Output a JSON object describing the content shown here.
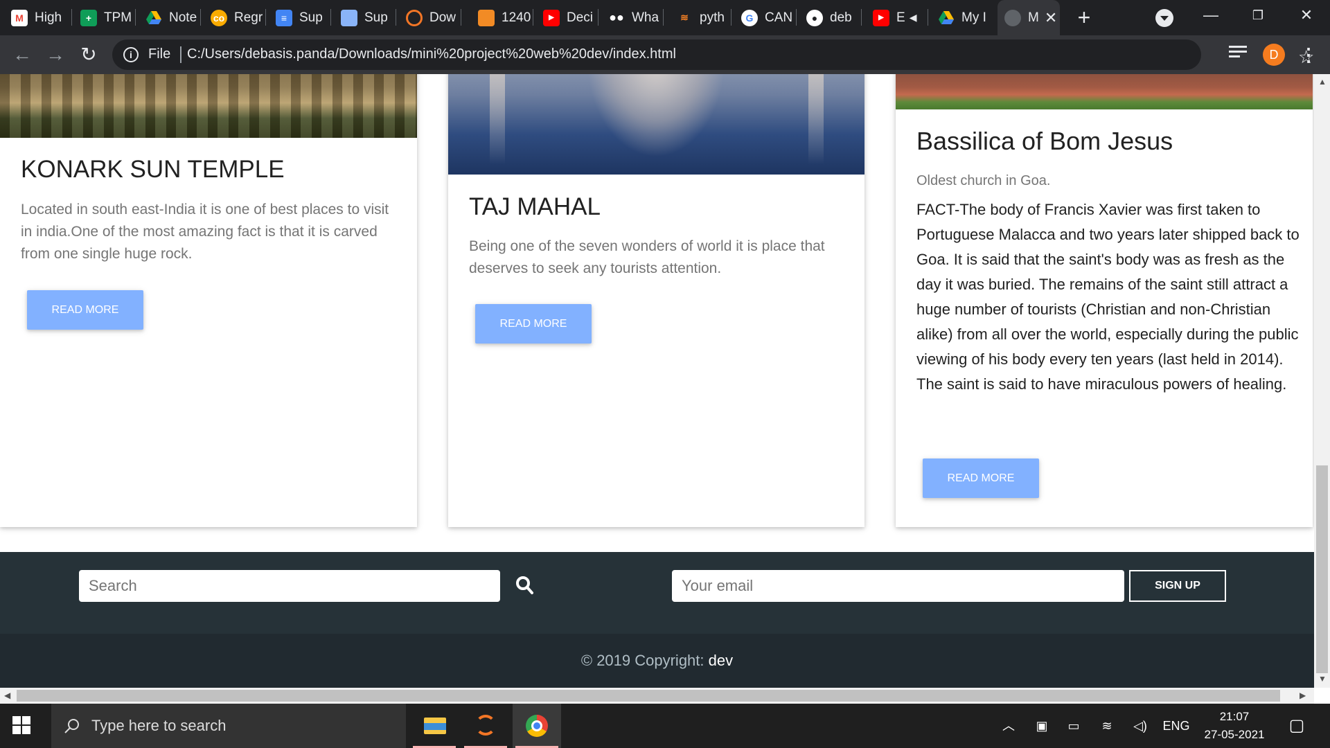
{
  "browser": {
    "tabs": [
      {
        "label": "High",
        "icon": "gmail-icon",
        "color": "#ea4335"
      },
      {
        "label": "TPM",
        "icon": "sheets-icon",
        "color": "#0f9d58"
      },
      {
        "label": "Note",
        "icon": "drive-icon",
        "color": "#fbbc04"
      },
      {
        "label": "Regr",
        "icon": "colab-icon",
        "color": "#f9ab00"
      },
      {
        "label": "Sup",
        "icon": "docs-icon",
        "color": "#4285f4"
      },
      {
        "label": "Sup",
        "icon": "image-icon",
        "color": "#8ab4f8"
      },
      {
        "label": "Dow",
        "icon": "jupyter-icon",
        "color": "#f37626"
      },
      {
        "label": "1240",
        "icon": "book-icon",
        "color": "#f28b25"
      },
      {
        "label": "Deci",
        "icon": "youtube-icon",
        "color": "#ff0000"
      },
      {
        "label": "Wha",
        "icon": "medium-icon",
        "color": "#ffffff"
      },
      {
        "label": "pyth",
        "icon": "stackoverflow-icon",
        "color": "#f48024"
      },
      {
        "label": "CAN",
        "icon": "google-icon",
        "color": "#4285f4"
      },
      {
        "label": "deb",
        "icon": "github-icon",
        "color": "#ffffff"
      },
      {
        "label": "E",
        "icon": "youtube-icon",
        "color": "#ff0000"
      },
      {
        "label": "My I",
        "icon": "drive-icon",
        "color": "#fbbc04"
      },
      {
        "label": "M",
        "icon": "globe-icon",
        "color": "#9aa0a6"
      }
    ],
    "new_tab": "+",
    "address": {
      "scheme_label": "File",
      "url": "C:/Users/debasis.panda/Downloads/mini%20project%20web%20dev/index.html"
    },
    "profile_initial": "D"
  },
  "cards": [
    {
      "title": "KONARK SUN TEMPLE",
      "text": "Located in south east-India it is one of best places to visit in india.One of the most amazing fact is that it is carved from one single huge rock.",
      "button": "Read More"
    },
    {
      "title": "TAJ MAHAL",
      "text": "Being one of the seven wonders of world it is place that deserves to seek any tourists attention.",
      "button": "Read More"
    },
    {
      "title": "Bassilica of Bom Jesus",
      "subtitle": "Oldest church in Goa.",
      "text": "FACT-The body of Francis Xavier was first taken to Portuguese Malacca and two years later shipped back to Goa. It is said that the saint's body was as fresh as the day it was buried. The remains of the saint still attract a huge number of tourists (Christian and non-Christian alike) from all over the world, especially during the public viewing of his body every ten years (last held in 2014). The saint is said to have miraculous powers of healing.",
      "button": "Read More"
    }
  ],
  "footer": {
    "search_placeholder": "Search",
    "email_placeholder": "Your email",
    "signup": "SIGN UP",
    "copyright": "© 2019 Copyright: ",
    "brand": "dev"
  },
  "taskbar": {
    "search_placeholder": "Type here to search",
    "language": "ENG",
    "time": "21:07",
    "date": "27-05-2021"
  }
}
